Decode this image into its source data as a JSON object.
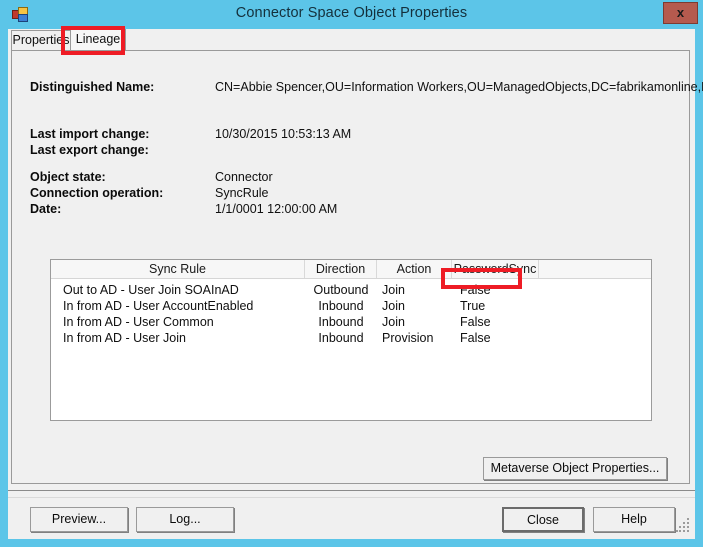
{
  "window": {
    "title": "Connector Space Object Properties",
    "icon": "app-squares-icon",
    "close_label": "x",
    "frame_color": "#5CC5E8",
    "close_color": "#B55A4E"
  },
  "tabs": [
    {
      "label": "Properties",
      "selected": false
    },
    {
      "label": "Lineage",
      "selected": true
    }
  ],
  "fields": [
    {
      "label": "Distinguished Name:",
      "value": "CN=Abbie Spencer,OU=Information Workers,OU=ManagedObjects,DC=fabrikamonline,DC=com"
    },
    {
      "label": "Last import change:",
      "value": "10/30/2015 10:53:13 AM"
    },
    {
      "label": "Last export change:",
      "value": ""
    },
    {
      "label": "Object state:",
      "value": "Connector"
    },
    {
      "label": "Connection operation:",
      "value": "SyncRule"
    },
    {
      "label": "Date:",
      "value": "1/1/0001 12:00:00 AM"
    }
  ],
  "table": {
    "columns": [
      "Sync Rule",
      "Direction",
      "Action",
      "PasswordSync",
      ""
    ],
    "rows": [
      {
        "sync_rule": "Out to AD - User Join SOAInAD",
        "direction": "Outbound",
        "action": "Join",
        "password_sync": "False"
      },
      {
        "sync_rule": "In from AD - User AccountEnabled",
        "direction": "Inbound",
        "action": "Join",
        "password_sync": "True"
      },
      {
        "sync_rule": "In from AD - User Common",
        "direction": "Inbound",
        "action": "Join",
        "password_sync": "False"
      },
      {
        "sync_rule": "In from AD - User Join",
        "direction": "Inbound",
        "action": "Provision",
        "password_sync": "False"
      }
    ]
  },
  "buttons": {
    "metaverse": "Metaverse Object Properties...",
    "preview": "Preview...",
    "log": "Log...",
    "close": "Close",
    "help": "Help"
  },
  "annotations": {
    "color": "#EE1C25",
    "highlighted_tab": "Lineage",
    "highlighted_cell": "True"
  }
}
